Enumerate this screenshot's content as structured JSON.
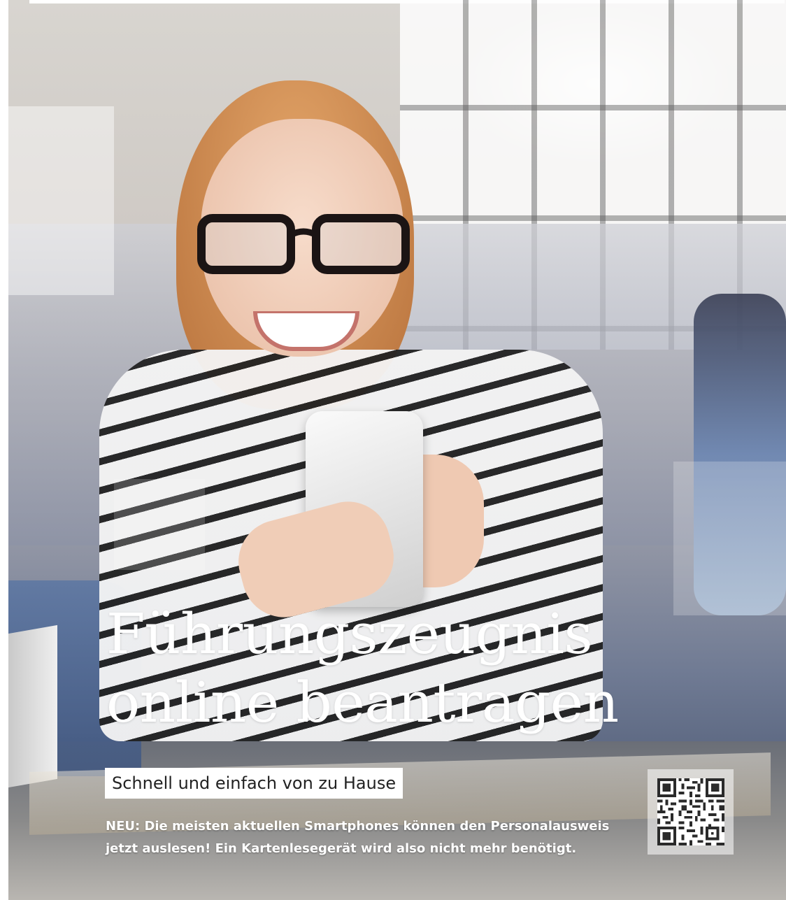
{
  "headline": {
    "line1": "Führungszeugnis",
    "line2": "online beantragen"
  },
  "subtitle": "Schnell und einfach von zu Hause",
  "note": "NEU: Die meisten aktuellen Smartphones können den Personalausweis jetzt auslesen! Ein Kartenlesegerät wird also nicht mehr benötigt.",
  "colors": {
    "text_light": "#ffffff",
    "label_background": "#ffffff",
    "label_text": "#222222"
  },
  "icons": {
    "qr": "qr-code-icon"
  }
}
